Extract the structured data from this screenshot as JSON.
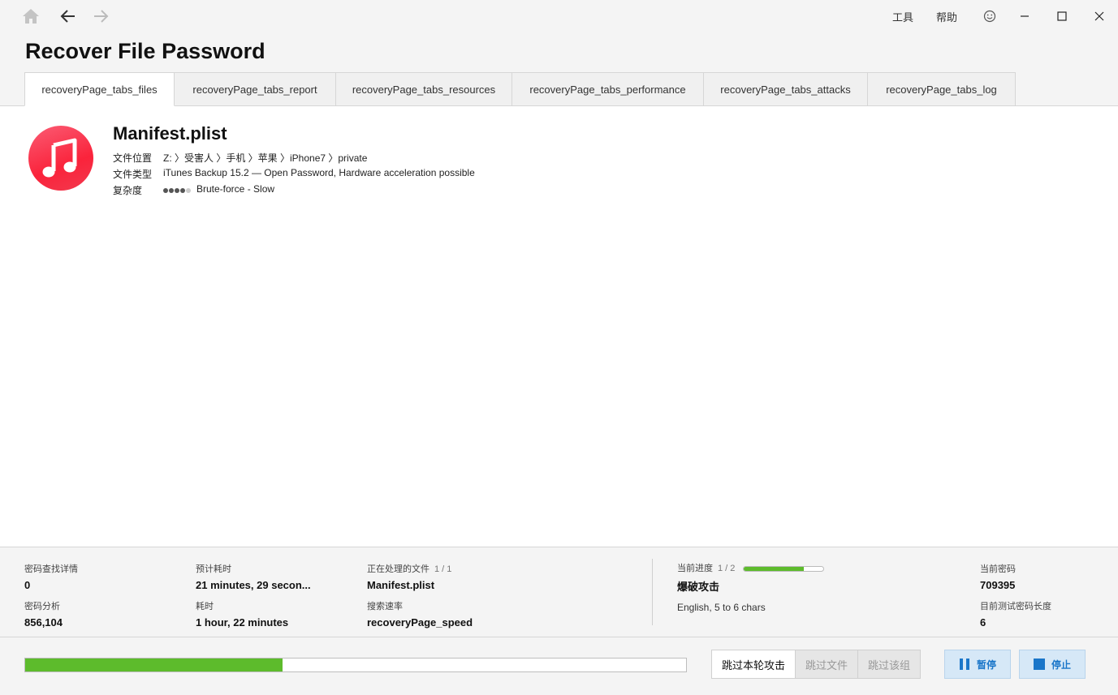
{
  "titlebar": {
    "tools_label": "工具",
    "help_label": "帮助"
  },
  "page_title": "Recover File Password",
  "tabs": [
    {
      "label": "recoveryPage_tabs_files",
      "active": true
    },
    {
      "label": "recoveryPage_tabs_report",
      "active": false
    },
    {
      "label": "recoveryPage_tabs_resources",
      "active": false
    },
    {
      "label": "recoveryPage_tabs_performance",
      "active": false
    },
    {
      "label": "recoveryPage_tabs_attacks",
      "active": false
    },
    {
      "label": "recoveryPage_tabs_log",
      "active": false
    }
  ],
  "file": {
    "name": "Manifest.plist",
    "location_label": "文件位置",
    "location_value": "Z: 〉受害人 〉手机 〉苹果 〉iPhone7 〉private",
    "type_label": "文件类型",
    "type_value": "iTunes Backup 15.2 — Open Password, Hardware acceleration possible",
    "complexity_label": "复杂度",
    "complexity_value": "Brute-force - Slow",
    "complexity_level": 4,
    "complexity_max": 5,
    "icon": "music-note-icon",
    "icon_color": "#fa233b"
  },
  "stats": {
    "found_label": "密码查找详情",
    "found_value": "0",
    "analyzed_label": "密码分析",
    "analyzed_value": "856,104",
    "eta_label": "预计耗时",
    "eta_value": "21 minutes, 29 secon...",
    "elapsed_label": "耗时",
    "elapsed_value": "1 hour, 22 minutes",
    "processing_label": "正在处理的文件",
    "processing_count": "1 / 1",
    "processing_value": "Manifest.plist",
    "speed_label": "搜索速率",
    "speed_value": "recoveryPage_speed",
    "progress_label": "当前进度",
    "progress_count": "1 / 2",
    "progress_fraction": 0.75,
    "attack_name": "爆破攻击",
    "attack_detail": "English, 5 to 6 chars",
    "current_pw_label": "当前密码",
    "current_pw_value": "709395",
    "pw_length_label": "目前测试密码长度",
    "pw_length_value": "6"
  },
  "bottom": {
    "overall_progress": 0.389,
    "skip_round_label": "跳过本轮攻击",
    "skip_file_label": "跳过文件",
    "skip_group_label": "跳过该组",
    "pause_label": "暂停",
    "stop_label": "停止"
  },
  "colors": {
    "accent": "#1a76c9",
    "progress": "#5dbb2c"
  }
}
